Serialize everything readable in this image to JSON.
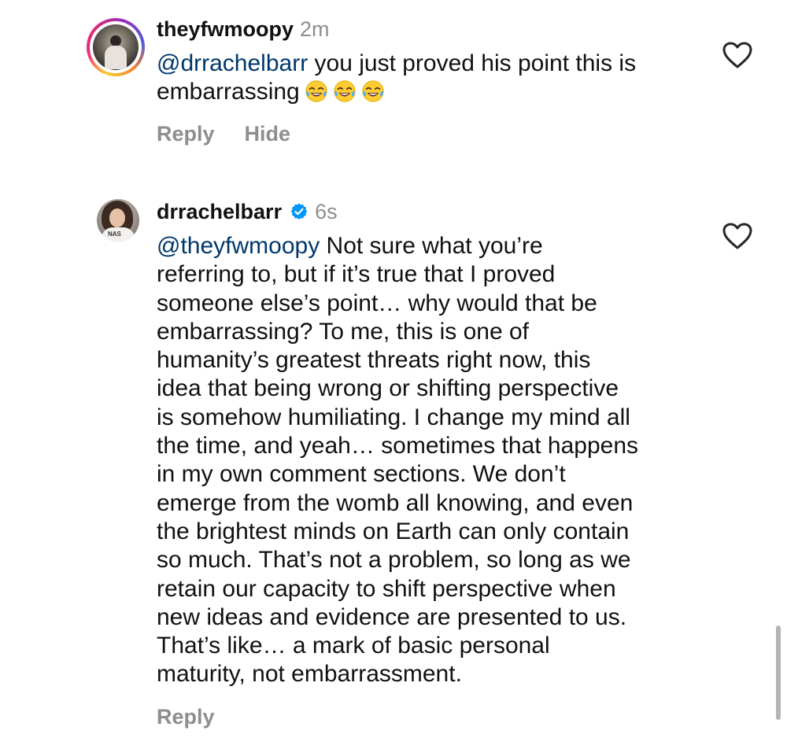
{
  "comments": [
    {
      "username": "theyfwmoopy",
      "timestamp": "2m",
      "mention": "@drrachelbarr",
      "text_line1": " you just proved his point this is",
      "text_line2": "embarrassing",
      "emojis": [
        "face-with-tears-of-joy-emoji",
        "face-with-tears-of-joy-emoji",
        "face-with-tears-of-joy-emoji"
      ],
      "actions": [
        "Reply",
        "Hide"
      ],
      "has_story_ring": true
    },
    {
      "username": "drrachelbarr",
      "verified": true,
      "timestamp": "6s",
      "mention": "@theyfwmoopy",
      "text": " Not sure what you’re\nreferring to, but if it’s true that I proved\nsomeone else’s point… why would that be\nembarrassing? To me, this is one of\nhumanity’s greatest threats right now, this\nidea that being wrong or shifting perspective\nis somehow humiliating. I change my mind all\nthe time, and yeah… sometimes that happens\nin my own comment sections. We don’t\nemerge from the womb all knowing, and even\nthe brightest minds on Earth can only contain\nso much. That’s not a problem, so long as we\nretain our capacity to shift perspective when\nnew ideas and evidence are presented to us.\nThat’s like… a mark of basic personal\nmaturity, not embarrassment.",
      "actions": [
        "Reply"
      ],
      "avatar_shirt_text": "NAS"
    }
  ],
  "colors": {
    "mention": "#00376b",
    "muted": "#8e8e8e",
    "verified": "#0095f6",
    "text": "#111111"
  },
  "icons": {
    "like": "heart-outline-icon",
    "verified": "verified-badge-icon"
  }
}
